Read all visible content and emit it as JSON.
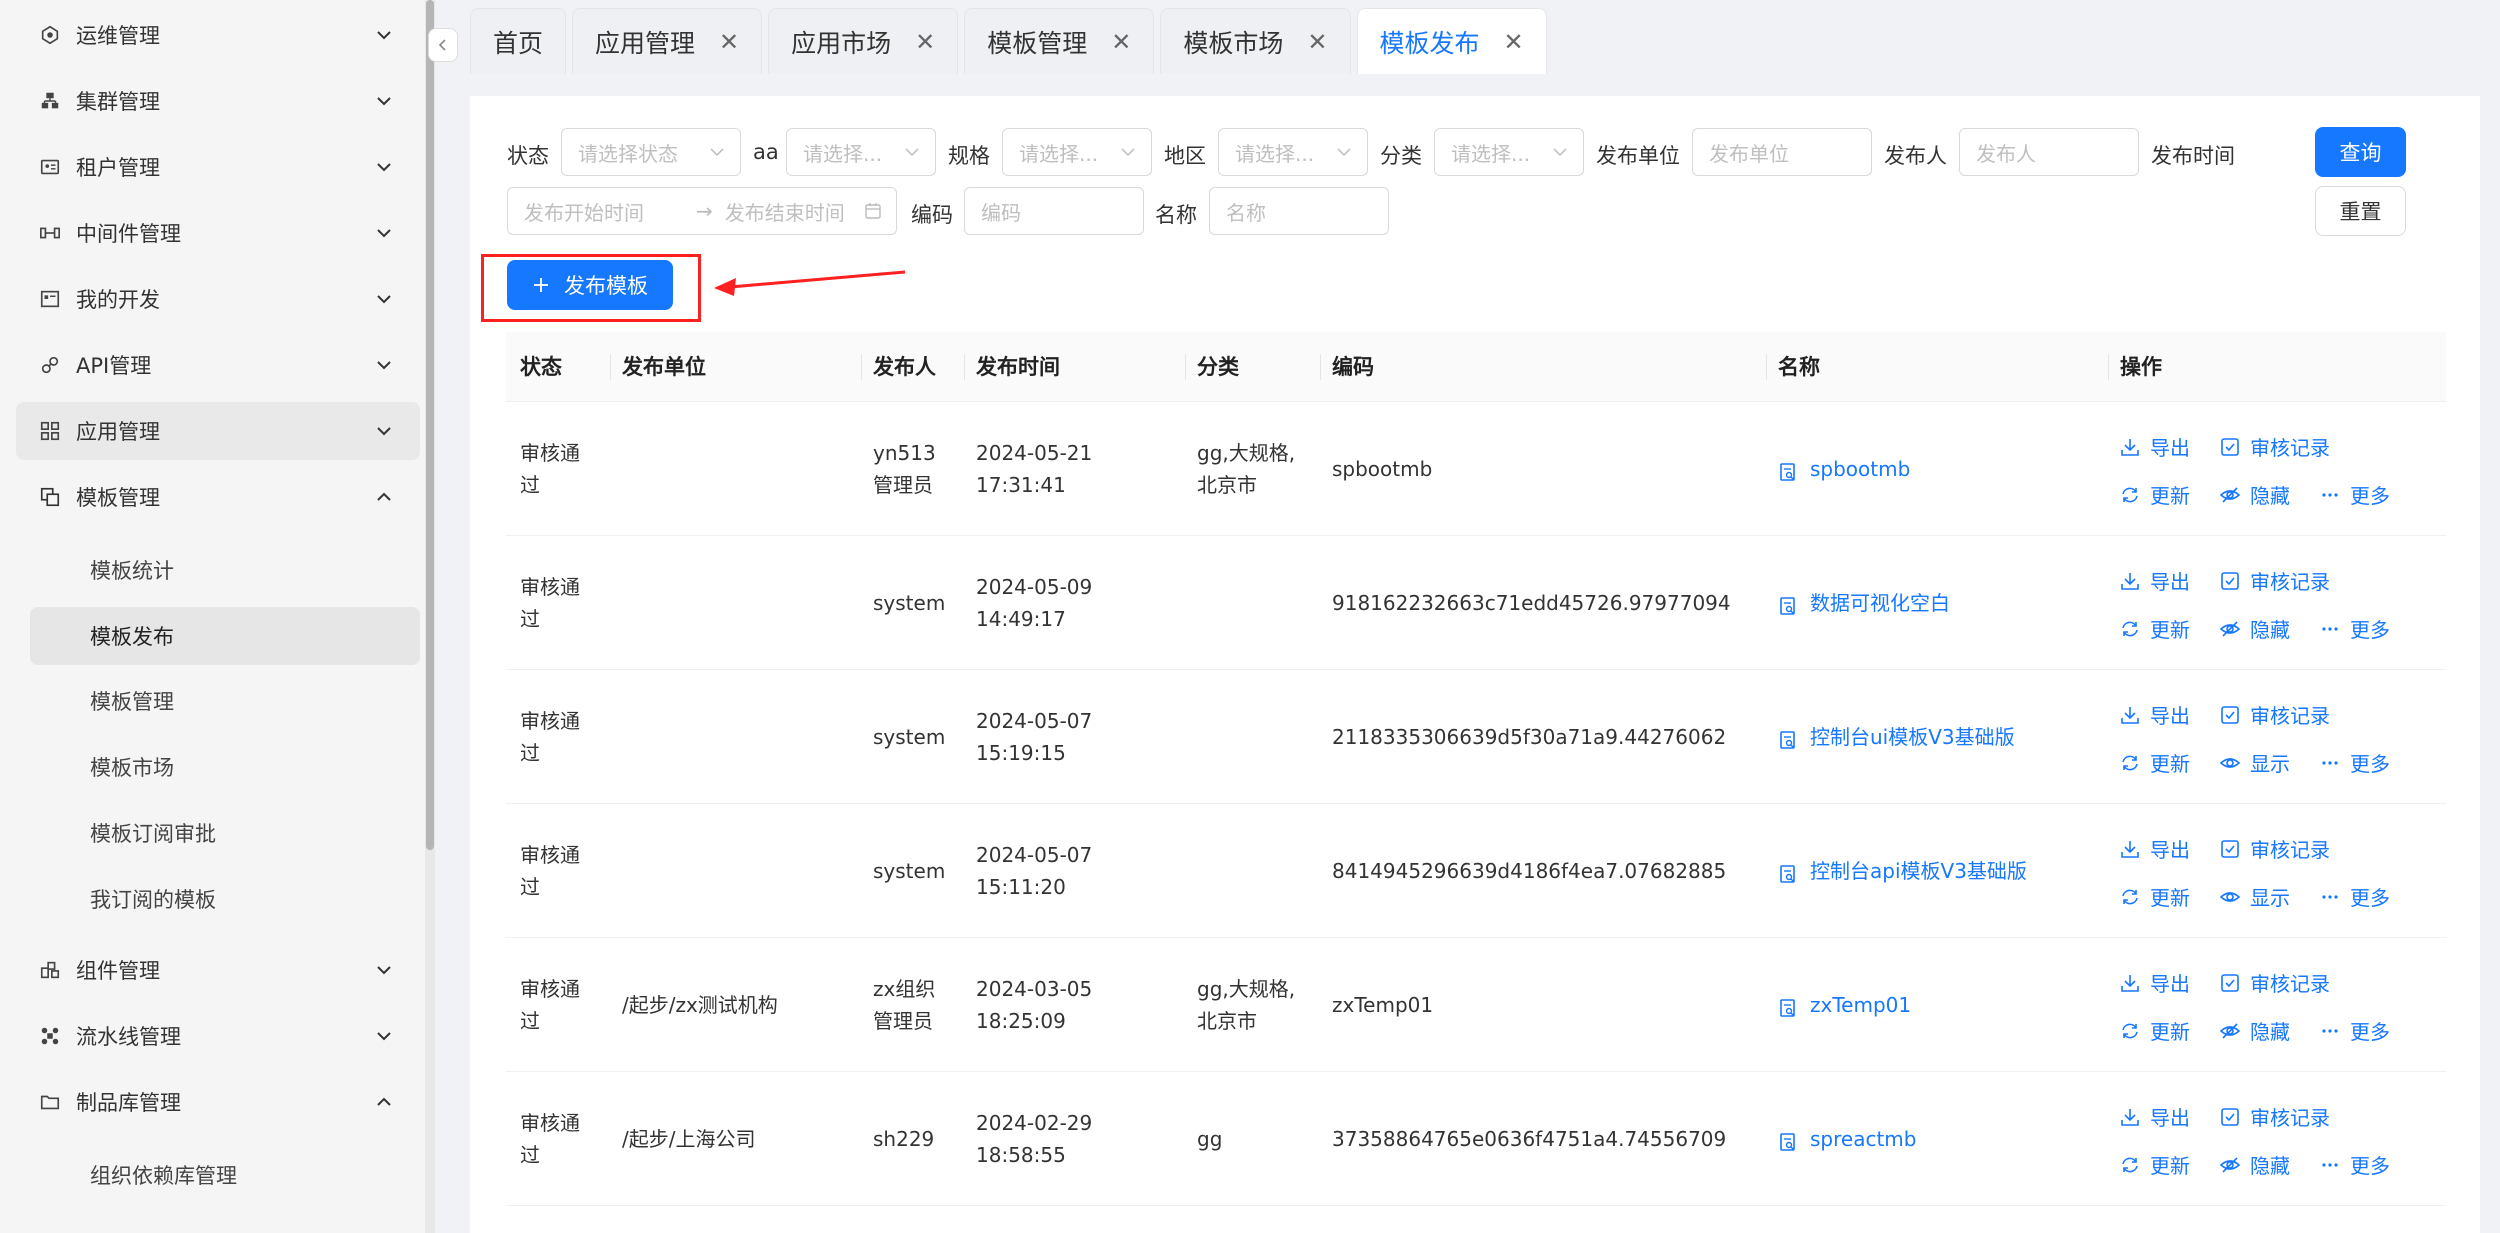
{
  "sidebar": {
    "items": [
      {
        "label": "运维管理",
        "icon": "ops-icon",
        "chevron": "down"
      },
      {
        "label": "集群管理",
        "icon": "cluster-icon",
        "chevron": "down"
      },
      {
        "label": "租户管理",
        "icon": "tenant-icon",
        "chevron": "down"
      },
      {
        "label": "中间件管理",
        "icon": "middleware-icon",
        "chevron": "down"
      },
      {
        "label": "我的开发",
        "icon": "dev-icon",
        "chevron": "down"
      },
      {
        "label": "API管理",
        "icon": "api-icon",
        "chevron": "down"
      },
      {
        "label": "应用管理",
        "icon": "apps-icon",
        "chevron": "down"
      },
      {
        "label": "模板管理",
        "icon": "template-icon",
        "chevron": "up"
      }
    ],
    "template_sub": [
      "模板统计",
      "模板发布",
      "模板管理",
      "模板市场",
      "模板订阅审批",
      "我订阅的模板"
    ],
    "items_after": [
      {
        "label": "组件管理",
        "icon": "component-icon",
        "chevron": "down"
      },
      {
        "label": "流水线管理",
        "icon": "pipeline-icon",
        "chevron": "down"
      },
      {
        "label": "制品库管理",
        "icon": "folder-icon",
        "chevron": "up"
      }
    ],
    "artifact_sub": [
      "组织依赖库管理"
    ]
  },
  "tabs": [
    {
      "label": "首页",
      "closable": false
    },
    {
      "label": "应用管理",
      "closable": true
    },
    {
      "label": "应用市场",
      "closable": true
    },
    {
      "label": "模板管理",
      "closable": true
    },
    {
      "label": "模板市场",
      "closable": true
    },
    {
      "label": "模板发布",
      "closable": true,
      "active": true
    }
  ],
  "close_glyph": "✕",
  "filters": {
    "status_label": "状态",
    "status_ph": "请选择状态",
    "aa_label": "aa",
    "aa_ph": "请选择...",
    "spec_label": "规格",
    "spec_ph": "请选择...",
    "region_label": "地区",
    "region_ph": "请选择...",
    "category_label": "分类",
    "category_ph": "请选择...",
    "unit_label": "发布单位",
    "unit_ph": "发布单位",
    "publisher_label": "发布人",
    "publisher_ph": "发布人",
    "time_label": "发布时间",
    "start_ph": "发布开始时间",
    "end_ph": "发布结束时间",
    "range_arrow": "→",
    "code_label": "编码",
    "code_ph": "编码",
    "name_label": "名称",
    "name_ph": "名称",
    "query_btn": "查询",
    "reset_btn": "重置"
  },
  "publish_btn": "发布模板",
  "table": {
    "headers": [
      "状态",
      "发布单位",
      "发布人",
      "发布时间",
      "分类",
      "编码",
      "名称",
      "操作"
    ],
    "rows": [
      {
        "status": [
          "审核通",
          "过"
        ],
        "unit": "",
        "publisher": [
          "yn513",
          "管理员"
        ],
        "time": [
          "2024-05-21",
          "17:31:41"
        ],
        "category": [
          "gg,大规格,",
          "北京市"
        ],
        "code": "spbootmb",
        "name": "spbootmb",
        "toggle": "隐藏",
        "toggle_icon": "eye-off"
      },
      {
        "status": [
          "审核通",
          "过"
        ],
        "unit": "",
        "publisher": [
          "system"
        ],
        "time": [
          "2024-05-09",
          "14:49:17"
        ],
        "category": [],
        "code": "918162232663c71edd45726.97977094",
        "name": "数据可视化空白",
        "toggle": "隐藏",
        "toggle_icon": "eye-off"
      },
      {
        "status": [
          "审核通",
          "过"
        ],
        "unit": "",
        "publisher": [
          "system"
        ],
        "time": [
          "2024-05-07",
          "15:19:15"
        ],
        "category": [],
        "code": "2118335306639d5f30a71a9.44276062",
        "name": "控制台ui模板V3基础版",
        "toggle": "显示",
        "toggle_icon": "eye"
      },
      {
        "status": [
          "审核通",
          "过"
        ],
        "unit": "",
        "publisher": [
          "system"
        ],
        "time": [
          "2024-05-07",
          "15:11:20"
        ],
        "category": [],
        "code": "8414945296639d4186f4ea7.07682885",
        "name": "控制台api模板V3基础版",
        "toggle": "显示",
        "toggle_icon": "eye"
      },
      {
        "status": [
          "审核通",
          "过"
        ],
        "unit": "/起步/zx测试机构",
        "publisher": [
          "zx组织",
          "管理员"
        ],
        "time": [
          "2024-03-05",
          "18:25:09"
        ],
        "category": [
          "gg,大规格,",
          "北京市"
        ],
        "code": "zxTemp01",
        "name": "zxTemp01",
        "toggle": "隐藏",
        "toggle_icon": "eye-off"
      },
      {
        "status": [
          "审核通",
          "过"
        ],
        "unit": "/起步/上海公司",
        "publisher": [
          "sh229"
        ],
        "time": [
          "2024-02-29",
          "18:58:55"
        ],
        "category": [
          "gg"
        ],
        "code": "37358864765e0636f4751a4.74556709",
        "name": "spreactmb",
        "toggle": "隐藏",
        "toggle_icon": "eye-off"
      }
    ],
    "actions": {
      "export": "导出",
      "audit": "审核记录",
      "update": "更新",
      "more": "更多"
    }
  },
  "colors": {
    "primary": "#1677ff",
    "highlight": "#ff2020"
  }
}
